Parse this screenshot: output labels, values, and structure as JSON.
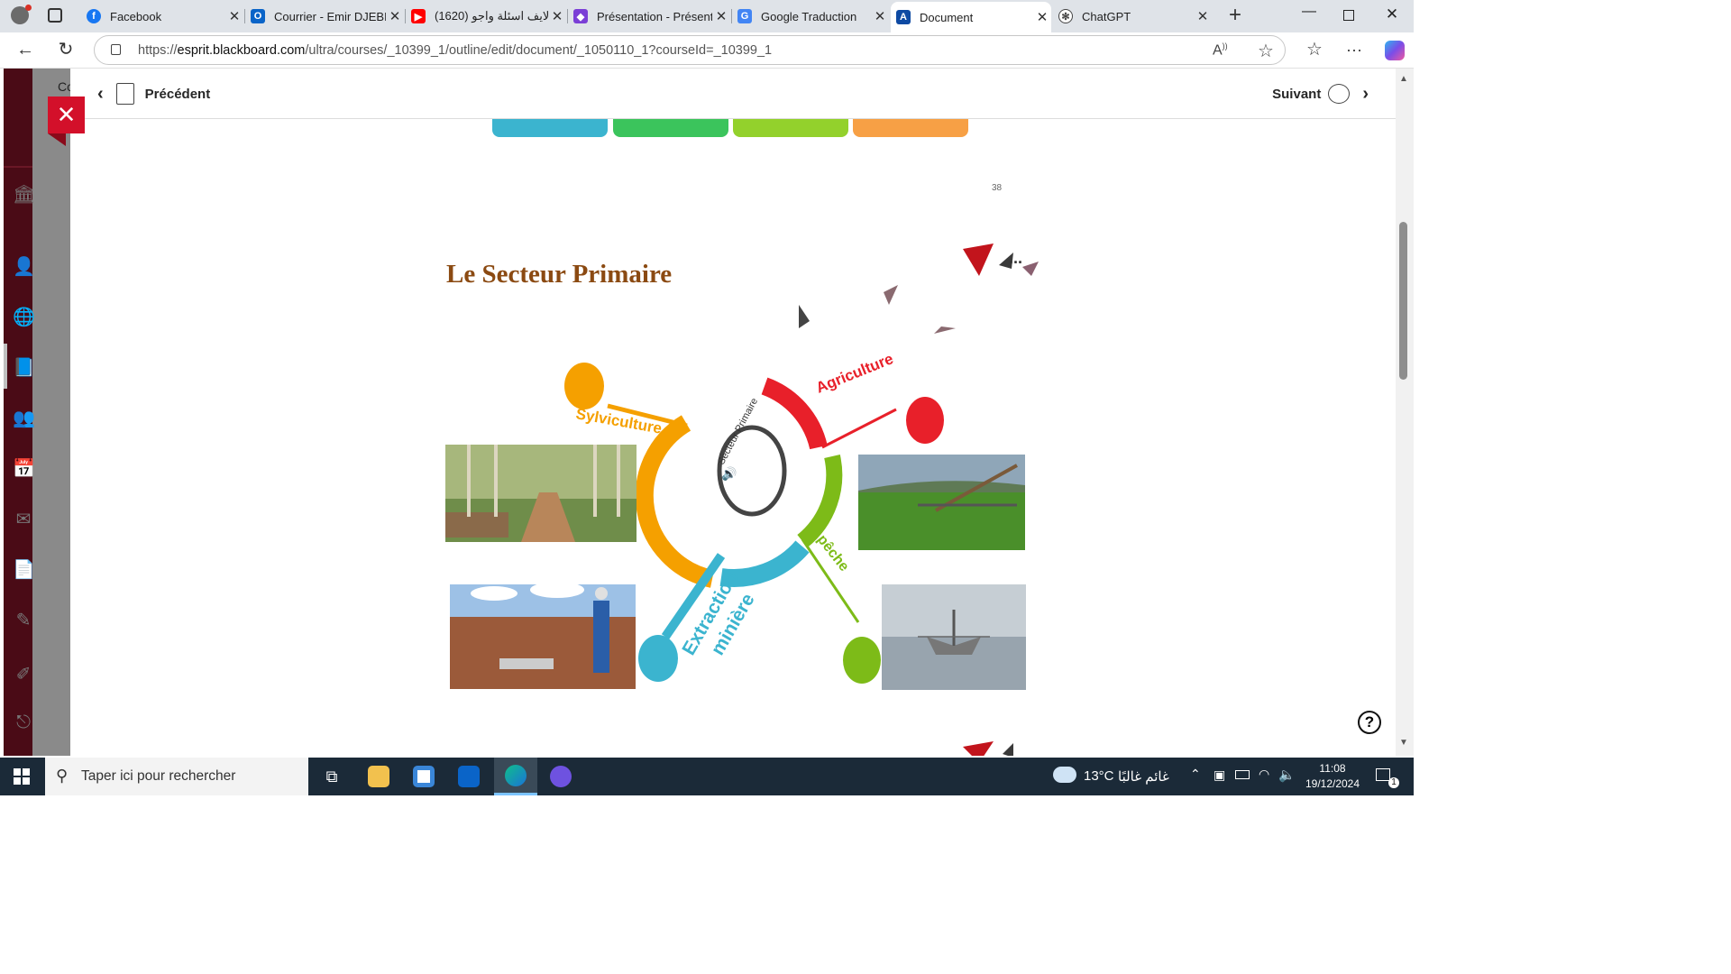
{
  "browser": {
    "tabs": [
      {
        "title": "Facebook",
        "icon": "facebook-icon",
        "color": "#1877f2"
      },
      {
        "title": "Courrier - Emir DJEBBI",
        "icon": "outlook-icon",
        "color": "#0a64c8"
      },
      {
        "title": "(1620) لايف اسئلة واجو",
        "icon": "youtube-icon",
        "color": "#ff0000"
      },
      {
        "title": "Présentation - Présentation",
        "icon": "presentation-icon",
        "color": "#7b3fd6"
      },
      {
        "title": "Google Traduction",
        "icon": "google-translate-icon",
        "color": "#4285f4"
      },
      {
        "title": "Document",
        "icon": "blackboard-icon",
        "color": "#0e4aa3"
      },
      {
        "title": "ChatGPT",
        "icon": "chatgpt-icon",
        "color": "#444444"
      }
    ],
    "active_tab": 5,
    "url_host": "esprit.blackboard.com",
    "url_prefix": "https://",
    "url_path": "/ultra/courses/_10399_1/outline/edit/document/_1050110_1?courseId=_10399_1"
  },
  "panel": {
    "prev_label": "Précédent",
    "next_label": "Suivant",
    "close_symbol": "✕",
    "behind_text": "Co"
  },
  "slide": {
    "page_number": "38",
    "title": "Le Secteur Primaire",
    "center_label": "Secteur Primaire",
    "branches": {
      "sylviculture": "Sylviculture",
      "agriculture": "Agriculture",
      "peche": "pêche",
      "extraction": "Extraction",
      "miniere": "minière"
    },
    "colors": {
      "orange": "#f5a000",
      "red": "#e8202a",
      "green": "#7dbb18",
      "blue": "#3bb4cf",
      "title": "#8b4a12"
    },
    "more_dots": "..."
  },
  "taskbar": {
    "search_placeholder": "Taper ici pour rechercher",
    "weather_temp": "13°C",
    "weather_text": "غائم غالبًا",
    "time": "11:08",
    "date": "19/12/2024",
    "notification_count": "1"
  }
}
